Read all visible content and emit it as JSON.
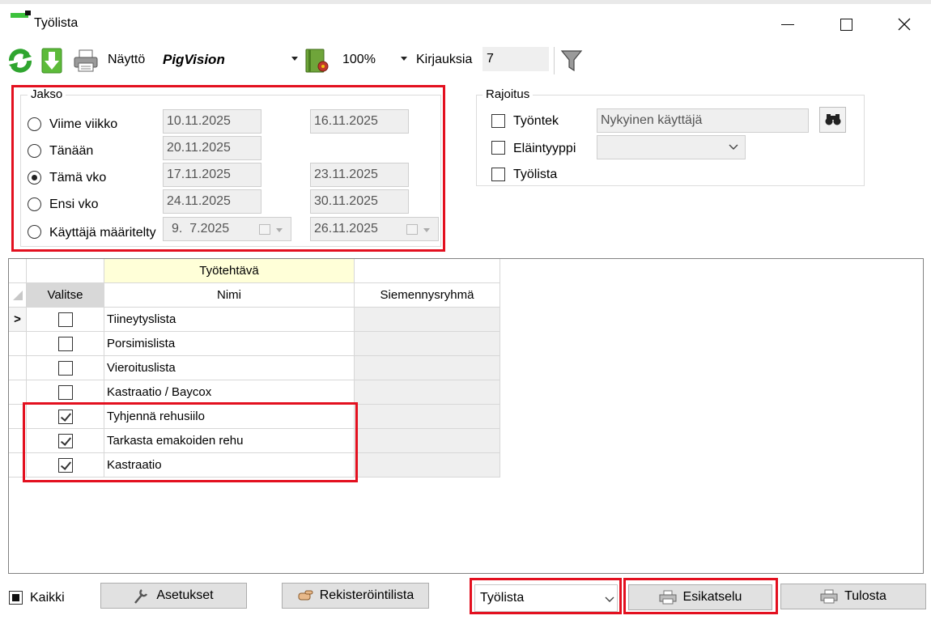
{
  "window": {
    "title": "Työlista"
  },
  "toolbar": {
    "display_label": "Näyttö",
    "display_value": "PigVision",
    "zoom_value": "100%",
    "entries_label": "Kirjauksia",
    "entries_count": "7"
  },
  "period": {
    "legend": "Jakso",
    "options": [
      {
        "label": "Viime viikko",
        "from": "10.11.2025",
        "to": "16.11.2025",
        "selected": false
      },
      {
        "label": "Tänään",
        "from": "20.11.2025",
        "to": "",
        "selected": false
      },
      {
        "label": "Tämä vko",
        "from": "17.11.2025",
        "to": "23.11.2025",
        "selected": true
      },
      {
        "label": "Ensi vko",
        "from": "24.11.2025",
        "to": "30.11.2025",
        "selected": false
      },
      {
        "label": "Käyttäjä määritelty",
        "from": "9.  7.2025",
        "to": "26.11.2025",
        "selected": false
      }
    ]
  },
  "restriction": {
    "legend": "Rajoitus",
    "employee_label": "Työntek",
    "employee_value": "Nykyinen käyttäjä",
    "animal_type_label": "Eläintyyppi",
    "animal_type_value": "",
    "worklist_label": "Työlista"
  },
  "grid": {
    "group_header": "Työtehtävä",
    "columns": [
      "Valitse",
      "Nimi",
      "Siemennysryhmä"
    ],
    "current_row_marker": ">",
    "rows": [
      {
        "name": "Tiineytyslista",
        "checked": false,
        "group": ""
      },
      {
        "name": "Porsimislista",
        "checked": false,
        "group": ""
      },
      {
        "name": "Vieroituslista",
        "checked": false,
        "group": ""
      },
      {
        "name": "Kastraatio / Baycox",
        "checked": false,
        "group": ""
      },
      {
        "name": "Tyhjennä rehusiilo",
        "checked": true,
        "group": ""
      },
      {
        "name": "Tarkasta emakoiden rehu",
        "checked": true,
        "group": ""
      },
      {
        "name": "Kastraatio",
        "checked": true,
        "group": ""
      }
    ]
  },
  "bottom": {
    "all_label": "Kaikki",
    "settings_label": "Asetukset",
    "register_list_label": "Rekisteröintilista",
    "report_select_value": "Työlista",
    "preview_label": "Esikatselu",
    "print_label": "Tulosta"
  },
  "colors": {
    "highlight": "#e3101f",
    "group_header_bg": "#ffffd8",
    "select_header_bg": "#d8d8d8"
  }
}
